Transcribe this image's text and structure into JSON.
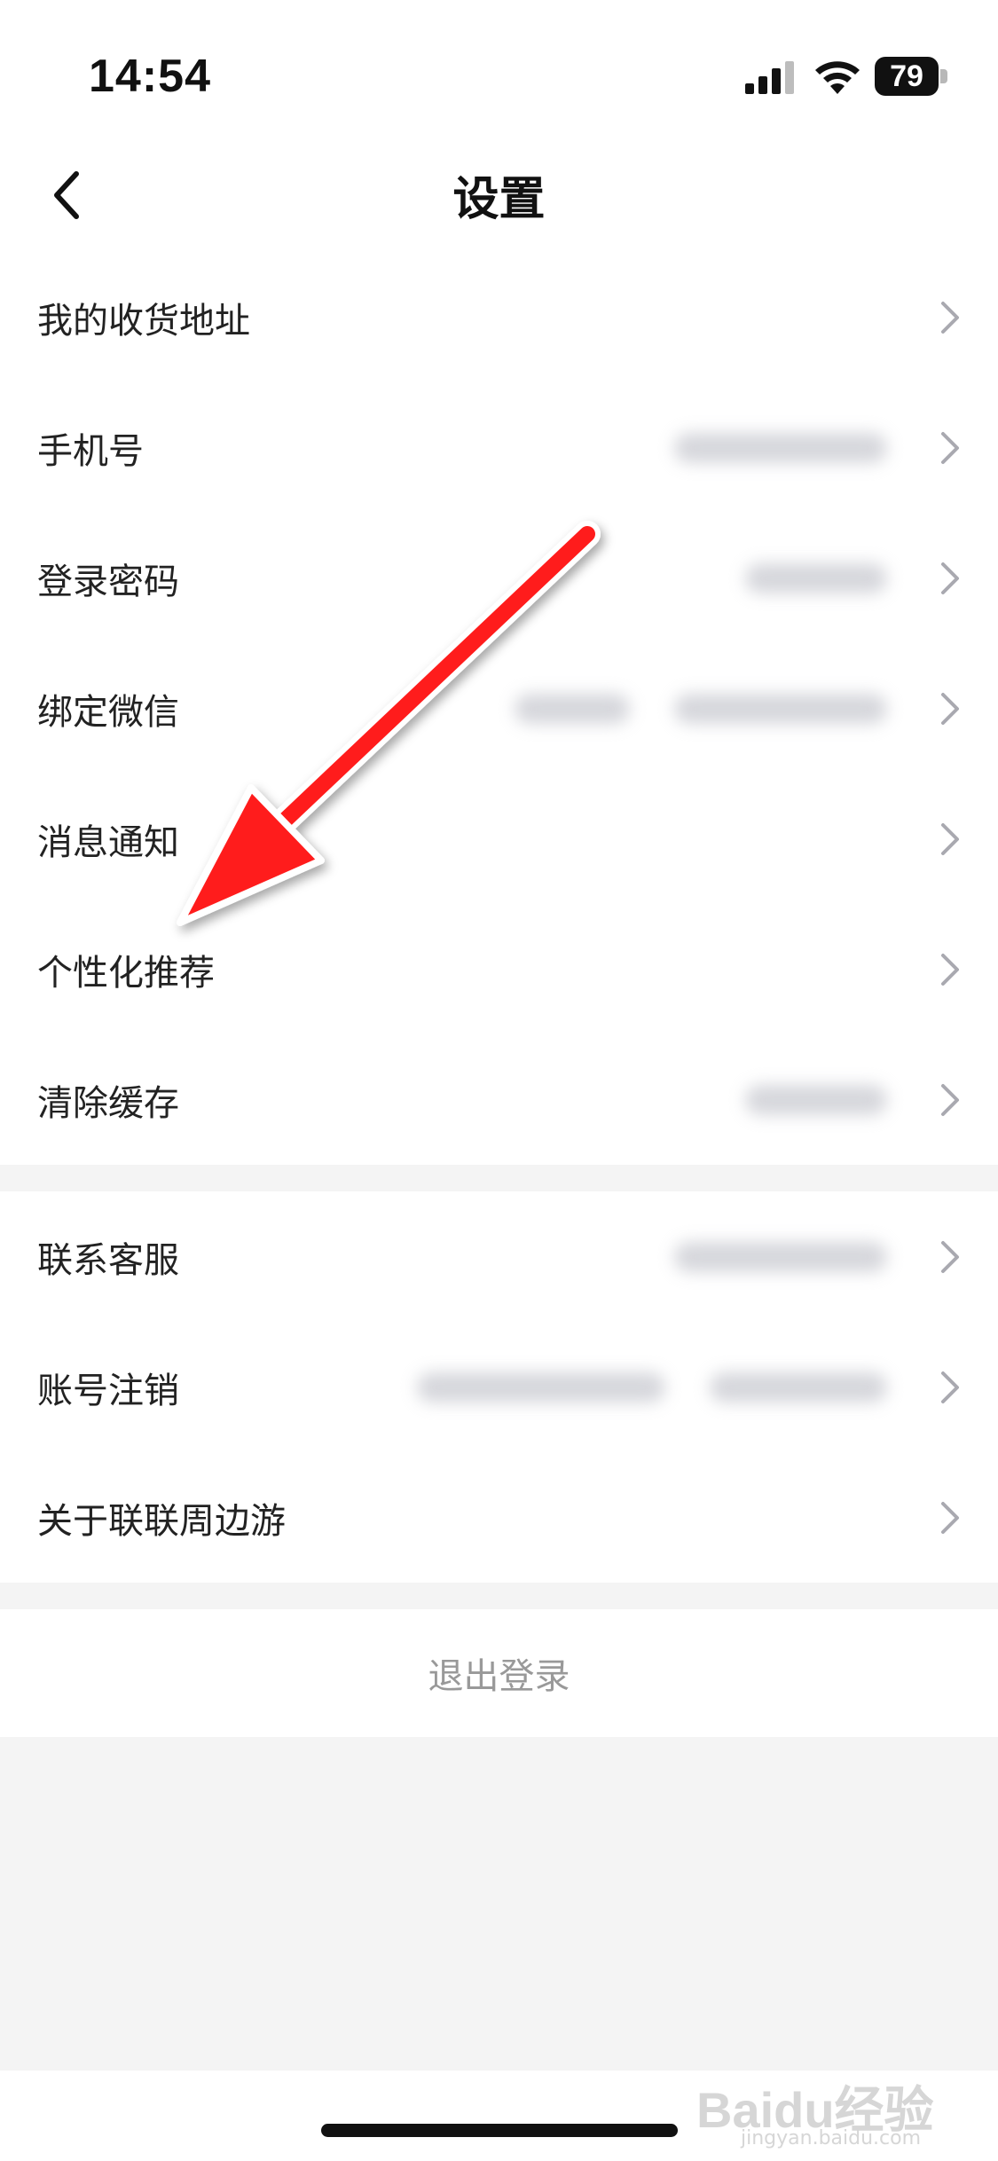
{
  "status_bar": {
    "time": "14:54",
    "battery": "79"
  },
  "nav": {
    "title": "设置",
    "back_icon": "chevron-left-icon"
  },
  "groups": [
    {
      "items": [
        {
          "label": "我的收货地址"
        },
        {
          "label": "手机号"
        },
        {
          "label": "登录密码"
        },
        {
          "label": "绑定微信"
        },
        {
          "label": "消息通知"
        },
        {
          "label": "个性化推荐"
        },
        {
          "label": "清除缓存"
        }
      ]
    },
    {
      "items": [
        {
          "label": "联系客服"
        },
        {
          "label": "账号注销"
        },
        {
          "label": "关于联联周边游"
        }
      ]
    }
  ],
  "logout": {
    "label": "退出登录"
  },
  "annotation": {
    "color": "#ff1a1a"
  },
  "watermark": {
    "brand": "Baidu经验",
    "url": "jingyan.baidu.com"
  }
}
